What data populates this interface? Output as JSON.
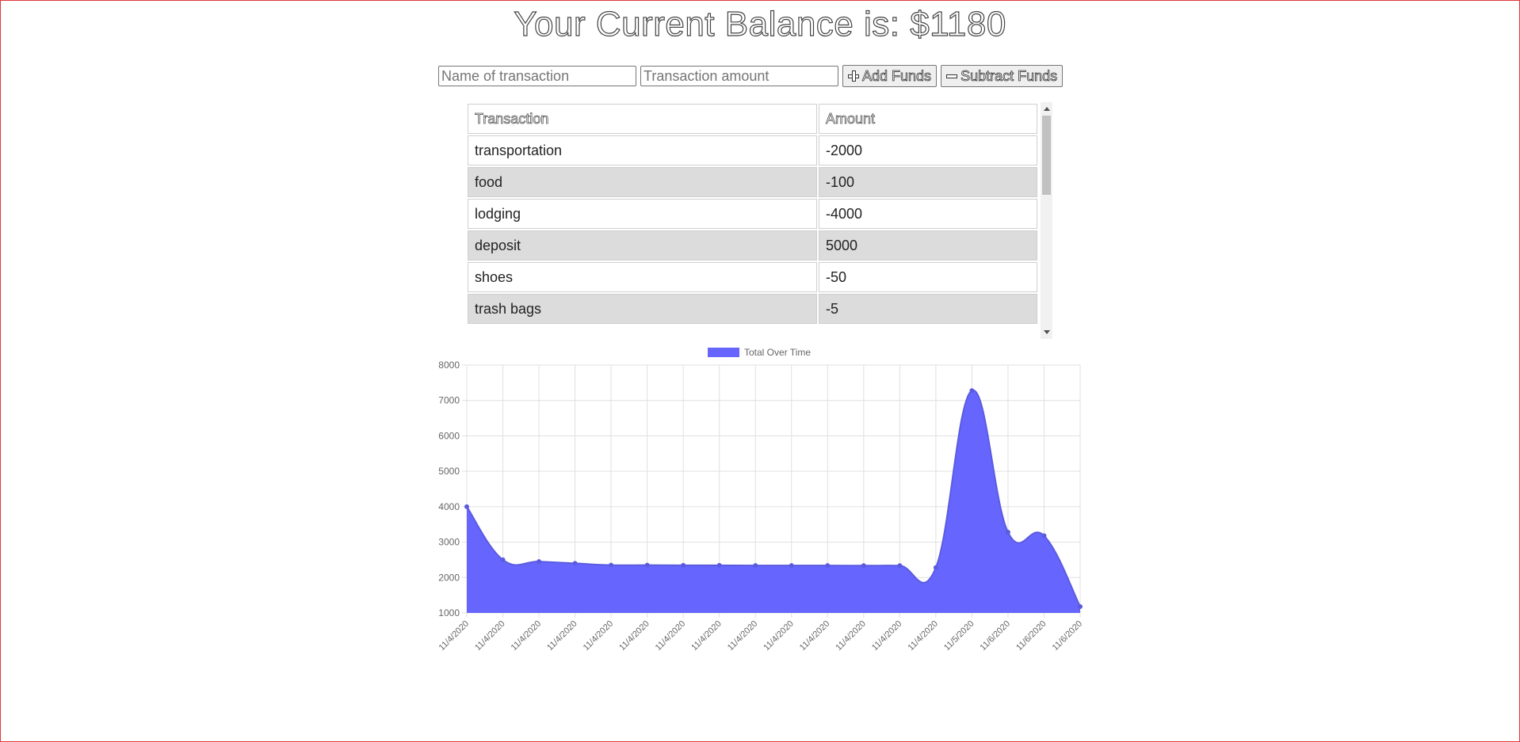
{
  "balance_text": "Your Current Balance is: $1180",
  "form": {
    "name_placeholder": "Name of transaction",
    "amount_placeholder": "Transaction amount",
    "add_label": "Add Funds",
    "subtract_label": "Subtract Funds"
  },
  "table": {
    "headers": [
      "Transaction",
      "Amount"
    ],
    "rows": [
      {
        "name": "transportation",
        "amount": "-2000"
      },
      {
        "name": "food",
        "amount": "-100"
      },
      {
        "name": "lodging",
        "amount": "-4000"
      },
      {
        "name": "deposit",
        "amount": "5000"
      },
      {
        "name": "shoes",
        "amount": "-50"
      },
      {
        "name": "trash bags",
        "amount": "-5"
      }
    ]
  },
  "colors": {
    "series_fill": "#6666ff",
    "series_point": "#5b5be0",
    "grid": "#e0e0e0"
  },
  "chart_data": {
    "type": "area",
    "legend": [
      "Total Over Time"
    ],
    "legend_position": "top",
    "grid": true,
    "ylim": [
      1000,
      8000
    ],
    "yticks": [
      1000,
      2000,
      3000,
      4000,
      5000,
      6000,
      7000,
      8000
    ],
    "x": [
      "11/4/2020",
      "11/4/2020",
      "11/4/2020",
      "11/4/2020",
      "11/4/2020",
      "11/4/2020",
      "11/4/2020",
      "11/4/2020",
      "11/4/2020",
      "11/4/2020",
      "11/4/2020",
      "11/4/2020",
      "11/4/2020",
      "11/4/2020",
      "11/5/2020",
      "11/6/2020",
      "11/6/2020",
      "11/6/2020"
    ],
    "series": [
      {
        "name": "Total Over Time",
        "values": [
          4000,
          2500,
          2450,
          2400,
          2350,
          2350,
          2345,
          2345,
          2340,
          2340,
          2340,
          2335,
          2335,
          2280,
          7280,
          3280,
          3180,
          1180
        ]
      }
    ]
  }
}
